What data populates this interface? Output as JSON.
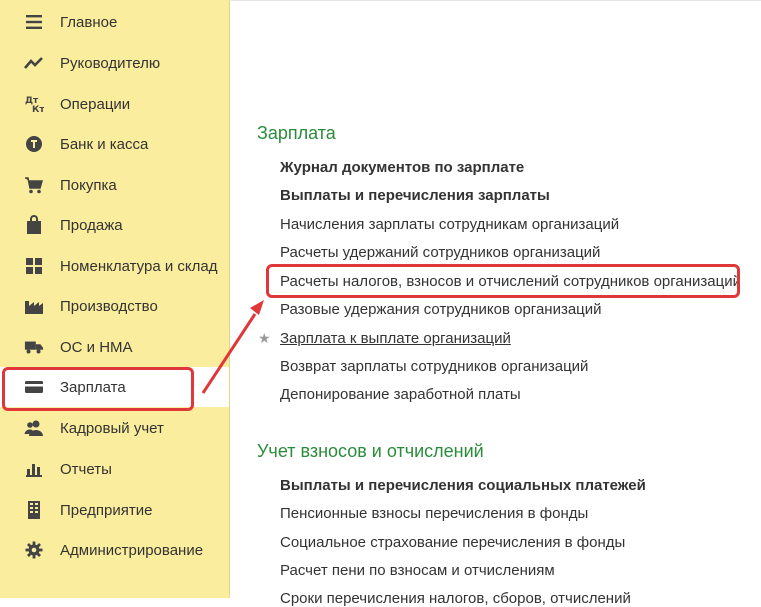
{
  "sidebar": {
    "items": [
      {
        "label": "Главное",
        "icon": "menu-lines-icon"
      },
      {
        "label": "Руководителю",
        "icon": "trend-chart-icon"
      },
      {
        "label": "Операции",
        "icon": "debit-credit-icon"
      },
      {
        "label": "Банк и касса",
        "icon": "coin-icon"
      },
      {
        "label": "Покупка",
        "icon": "cart-icon"
      },
      {
        "label": "Продажа",
        "icon": "shopping-bag-icon"
      },
      {
        "label": "Номенклатура и склад",
        "icon": "grid-icon"
      },
      {
        "label": "Производство",
        "icon": "factory-icon"
      },
      {
        "label": "ОС и НМА",
        "icon": "truck-icon"
      },
      {
        "label": "Зарплата",
        "icon": "wallet-card-icon"
      },
      {
        "label": "Кадровый учет",
        "icon": "people-icon"
      },
      {
        "label": "Отчеты",
        "icon": "bar-chart-icon"
      },
      {
        "label": "Предприятие",
        "icon": "building-icon"
      },
      {
        "label": "Администрирование",
        "icon": "gear-icon"
      }
    ],
    "active_index": 9
  },
  "main": {
    "salary_section": {
      "title": "Зарплата",
      "links": [
        "Журнал документов по зарплате",
        "Выплаты и перечисления зарплаты",
        "Начисления зарплаты сотрудникам организаций",
        "Расчеты удержаний сотрудников организаций",
        "Расчеты налогов, взносов и отчислений сотрудников организаций",
        "Разовые удержания сотрудников организаций",
        "Зарплата к выплате организаций",
        "Возврат зарплаты сотрудников организаций",
        "Депонирование заработной платы"
      ]
    },
    "contributions_section": {
      "title": "Учет взносов и отчислений",
      "links": [
        "Выплаты и перечисления социальных платежей",
        "Пенсионные взносы перечисления в фонды",
        "Социальное страхование перечисления в фонды",
        "Расчет пени по взносам и отчислениям",
        "Сроки перечисления налогов, сборов, отчислений"
      ]
    }
  },
  "colors": {
    "sidebar_bg": "#fbed9e",
    "section_title": "#2a8c3a",
    "highlight": "#e0373a"
  }
}
